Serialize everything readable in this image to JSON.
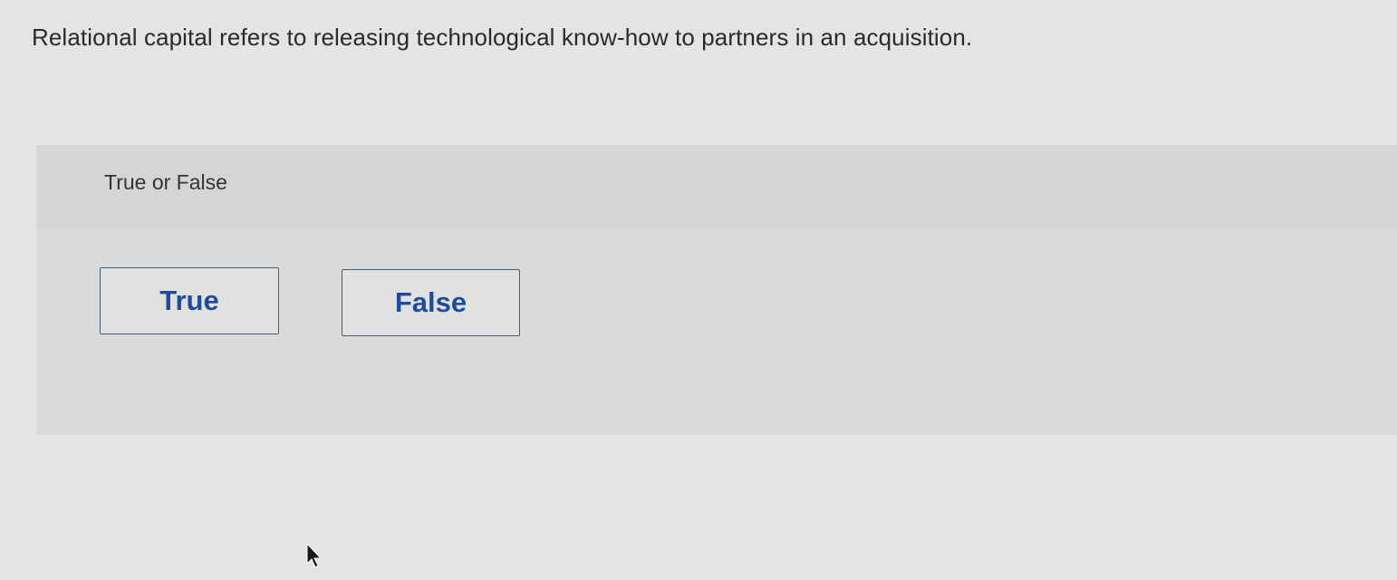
{
  "question": {
    "text": "Relational capital refers to releasing technological know-how to partners in an acquisition."
  },
  "answer_panel": {
    "header_label": "True or False",
    "choices": [
      {
        "label": "True"
      },
      {
        "label": "False"
      }
    ]
  },
  "colors": {
    "page_background": "#e4e4e2",
    "panel_background": "#dadad8",
    "panel_header_background": "#d5d5d3",
    "choice_text": "#1f4c9a",
    "choice_border": "#4a5a78"
  },
  "icons": {
    "cursor": "mouse-pointer-icon"
  }
}
